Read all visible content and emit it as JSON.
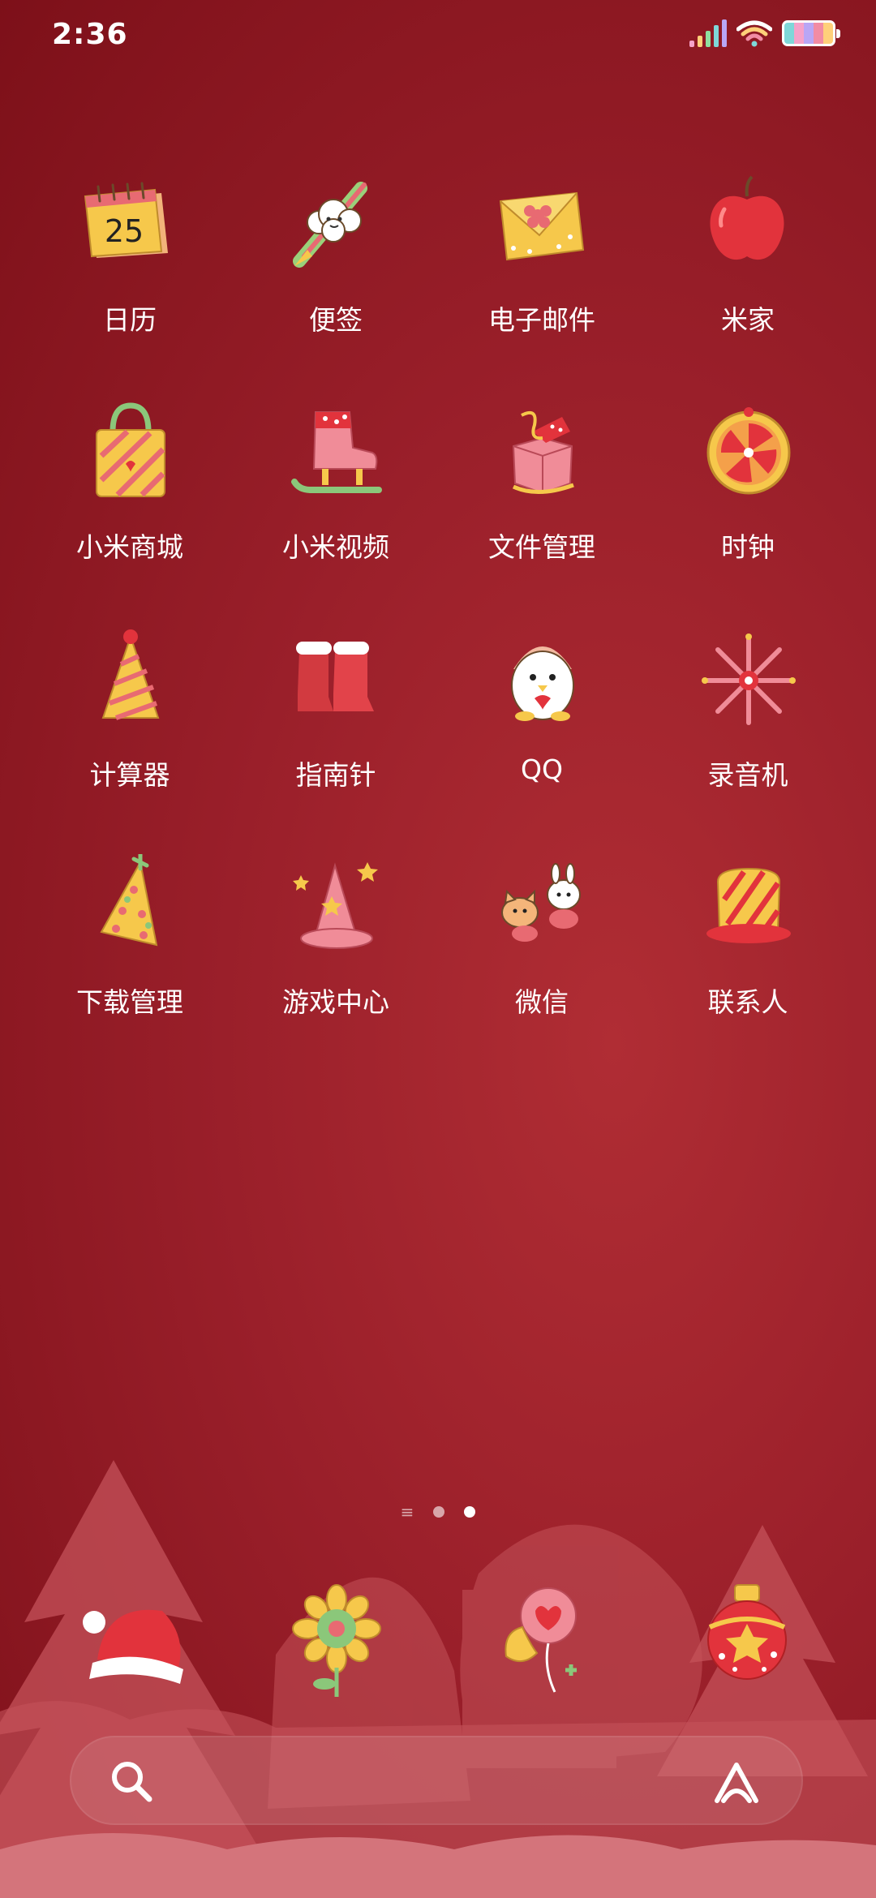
{
  "status_bar": {
    "time": "2:36"
  },
  "apps": [
    {
      "label": "日历",
      "icon": "calendar-icon",
      "date_number": "25"
    },
    {
      "label": "便签",
      "icon": "notes-icon"
    },
    {
      "label": "电子邮件",
      "icon": "email-icon"
    },
    {
      "label": "米家",
      "icon": "mi-home-icon"
    },
    {
      "label": "小米商城",
      "icon": "mi-store-icon"
    },
    {
      "label": "小米视频",
      "icon": "mi-video-icon"
    },
    {
      "label": "文件管理",
      "icon": "file-manager-icon"
    },
    {
      "label": "时钟",
      "icon": "clock-icon"
    },
    {
      "label": "计算器",
      "icon": "calculator-icon"
    },
    {
      "label": "指南针",
      "icon": "compass-icon"
    },
    {
      "label": "QQ",
      "icon": "qq-icon"
    },
    {
      "label": "录音机",
      "icon": "recorder-icon"
    },
    {
      "label": "下载管理",
      "icon": "download-manager-icon"
    },
    {
      "label": "游戏中心",
      "icon": "game-center-icon"
    },
    {
      "label": "微信",
      "icon": "wechat-icon"
    },
    {
      "label": "联系人",
      "icon": "contacts-icon"
    }
  ],
  "pager": {
    "pages": 2,
    "active": 2
  },
  "dock": [
    {
      "icon": "santa-hat-icon"
    },
    {
      "icon": "sunflower-icon"
    },
    {
      "icon": "heart-balloon-icon"
    },
    {
      "icon": "ornament-icon"
    }
  ],
  "colors": {
    "background": "#9a1f2a",
    "accent_yellow": "#f6c84b",
    "accent_pink": "#e86a72"
  }
}
